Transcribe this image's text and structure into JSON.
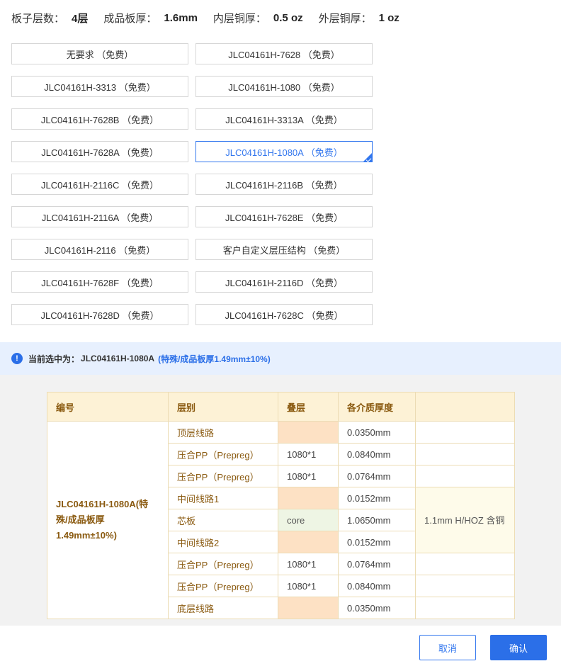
{
  "specs": {
    "layers_label": "板子层数：",
    "layers_value": "4层",
    "thickness_label": "成品板厚：",
    "thickness_value": "1.6mm",
    "inner_cu_label": "内层铜厚：",
    "inner_cu_value": "0.5 oz",
    "outer_cu_label": "外层铜厚：",
    "outer_cu_value": "1 oz"
  },
  "options": [
    {
      "label": "无要求 （免费）"
    },
    {
      "label": "JLC04161H-7628 （免费）"
    },
    {
      "label": "JLC04161H-3313 （免费）"
    },
    {
      "label": "JLC04161H-1080 （免费）"
    },
    {
      "label": "JLC04161H-7628B （免费）"
    },
    {
      "label": "JLC04161H-3313A （免费）"
    },
    {
      "label": "JLC04161H-7628A （免费）"
    },
    {
      "label": "JLC04161H-1080A （免费）",
      "selected": true
    },
    {
      "label": "JLC04161H-2116C （免费）"
    },
    {
      "label": "JLC04161H-2116B （免费）"
    },
    {
      "label": "JLC04161H-2116A （免费）"
    },
    {
      "label": "JLC04161H-7628E （免费）"
    },
    {
      "label": "JLC04161H-2116 （免费）"
    },
    {
      "label": "客户自定义层压结构 （免费）"
    },
    {
      "label": "JLC04161H-7628F （免费）"
    },
    {
      "label": "JLC04161H-2116D （免费）"
    },
    {
      "label": "JLC04161H-7628D （免费）"
    },
    {
      "label": "JLC04161H-7628C （免费）"
    }
  ],
  "notice": {
    "icon": "info-icon",
    "label": "当前选中为：",
    "code": "JLC04161H-1080A",
    "extra": "(特殊/成品板厚1.49mm±10%)"
  },
  "table": {
    "headers": [
      "编号",
      "层别",
      "叠层",
      "各介质厚度",
      ""
    ],
    "id_text": "JLC04161H-1080A(特殊/成品板厚1.49mm±10%)",
    "note_text": "1.1mm H/HOZ 含铜",
    "rows": [
      {
        "layer": "顶层线路",
        "stack": "",
        "thickness": "0.0350mm",
        "kind": "copper"
      },
      {
        "layer": "压合PP（Prepreg）",
        "stack": "1080*1",
        "thickness": "0.0840mm",
        "kind": "pp"
      },
      {
        "layer": "压合PP（Prepreg）",
        "stack": "1080*1",
        "thickness": "0.0764mm",
        "kind": "pp"
      },
      {
        "layer": "中间线路1",
        "stack": "",
        "thickness": "0.0152mm",
        "kind": "copper"
      },
      {
        "layer": "芯板",
        "stack": "core",
        "thickness": "1.0650mm",
        "kind": "core"
      },
      {
        "layer": "中间线路2",
        "stack": "",
        "thickness": "0.0152mm",
        "kind": "copper"
      },
      {
        "layer": "压合PP（Prepreg）",
        "stack": "1080*1",
        "thickness": "0.0764mm",
        "kind": "pp"
      },
      {
        "layer": "压合PP（Prepreg）",
        "stack": "1080*1",
        "thickness": "0.0840mm",
        "kind": "pp"
      },
      {
        "layer": "底层线路",
        "stack": "",
        "thickness": "0.0350mm",
        "kind": "copper"
      }
    ]
  },
  "buttons": {
    "cancel": "取消",
    "ok": "确认"
  },
  "colors": {
    "accent": "#2b6fe8",
    "header_bg": "#fdf2d6",
    "copper": "#fde1c4",
    "core": "#eef5e4"
  }
}
